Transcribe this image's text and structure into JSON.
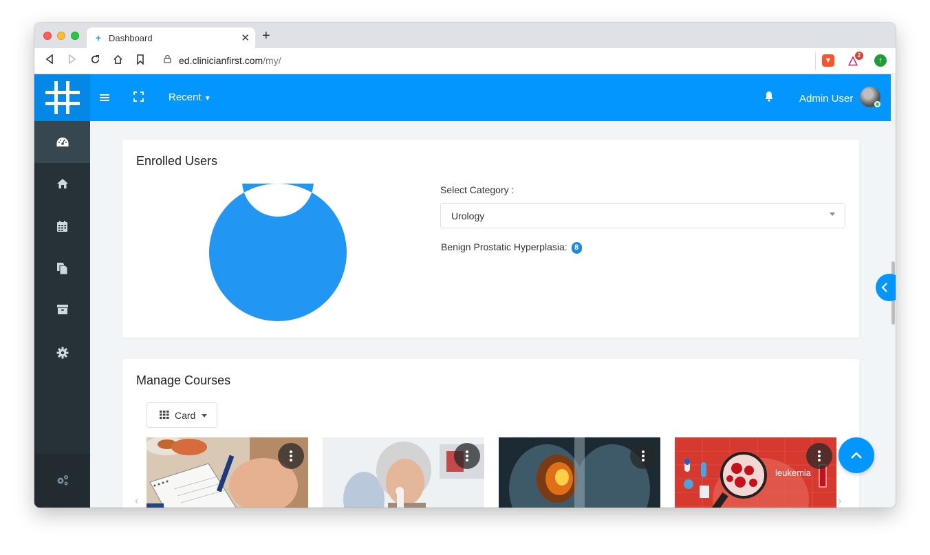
{
  "browser": {
    "tab_title": "Dashboard",
    "tab_favicon": "+",
    "url_host": "ed.clinicianfirst.com",
    "url_path": "/my/",
    "extension_badge": "2"
  },
  "header": {
    "recent_label": "Recent",
    "user_name": "Admin User"
  },
  "sidebar": {
    "items": [
      {
        "icon": "dashboard-icon",
        "active": true
      },
      {
        "icon": "home-icon",
        "active": false
      },
      {
        "icon": "calendar-icon",
        "active": false
      },
      {
        "icon": "files-icon",
        "active": false
      },
      {
        "icon": "archive-icon",
        "active": false
      },
      {
        "icon": "settings-icon",
        "active": false
      }
    ],
    "bottom_icon": "cogs-icon"
  },
  "enrolled_users": {
    "title": "Enrolled Users",
    "select_label": "Select Category :",
    "selected_category": "Urology",
    "course_name": "Benign Prostatic Hyperplasia:",
    "course_count": "8",
    "chart_color": "#2196f3"
  },
  "chart_data": {
    "type": "pie",
    "categories": [
      "Benign Prostatic Hyperplasia"
    ],
    "values": [
      8
    ],
    "title": "",
    "donut": true
  },
  "manage_courses": {
    "title": "Manage Courses",
    "view_label": "Card",
    "courses": [
      {
        "image": "notebook-pen-photo"
      },
      {
        "image": "inhaler-patient-photo"
      },
      {
        "image": "lung-xray-photo"
      },
      {
        "image": "leukemia-illustration",
        "image_text": "leukemia"
      }
    ]
  },
  "colors": {
    "primary": "#0496ff",
    "sidebar": "#263238"
  }
}
